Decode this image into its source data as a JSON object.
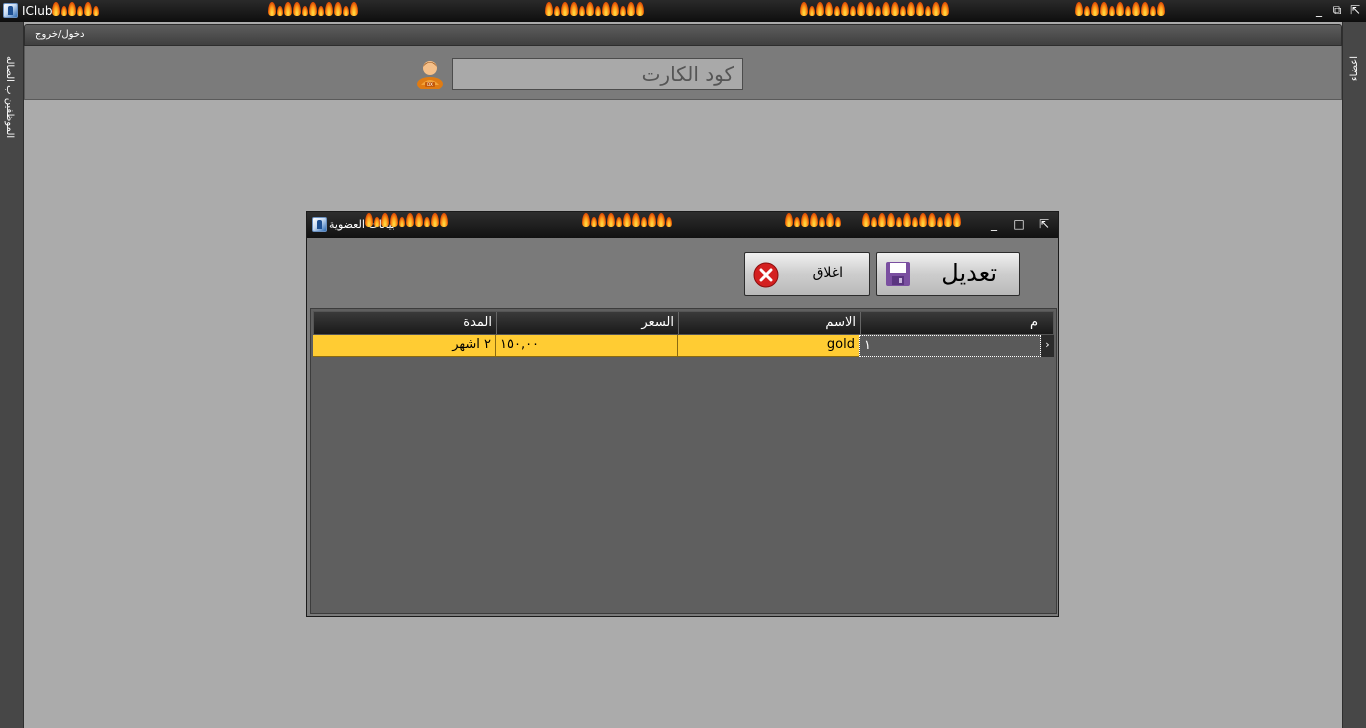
{
  "app": {
    "title": "IClub"
  },
  "left_panel": {
    "label": "الموظفين ب الصاله"
  },
  "right_panel": {
    "label": "اعضاء"
  },
  "menu": {
    "login_logout": "دخول/خروج"
  },
  "search": {
    "card_code_placeholder": "كود الكارت"
  },
  "dialog": {
    "title": "بيانات العضوية",
    "edit_label": "تعديل",
    "close_label": "اغلاق"
  },
  "grid": {
    "columns": [
      "م",
      "الاسم",
      "السعر",
      "المدة"
    ],
    "rows": [
      {
        "num": "١",
        "name": "gold",
        "price": "١٥٠,٠٠",
        "duration": "٢ اشهر"
      }
    ]
  },
  "colors": {
    "row_highlight": "#ffcc33",
    "background": "#ababab"
  }
}
